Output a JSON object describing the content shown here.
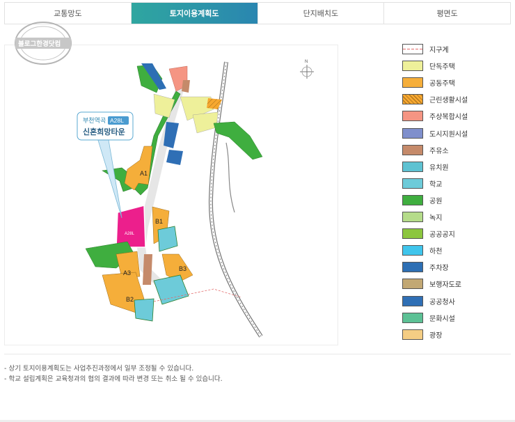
{
  "tabs": [
    {
      "label": "교통망도",
      "active": false
    },
    {
      "label": "토지이용계획도",
      "active": true
    },
    {
      "label": "단지배치도",
      "active": false
    },
    {
      "label": "평면도",
      "active": false
    }
  ],
  "map": {
    "stamp_text": "블로그한경닷컴",
    "callout": {
      "line1": "부천역곡",
      "tag": "A28L",
      "line2": "신혼희망타운"
    },
    "lots": [
      "A1",
      "A28L",
      "B1",
      "A3",
      "B3",
      "B2"
    ],
    "north_label": "N"
  },
  "legend": [
    {
      "label": "지구계",
      "color": "#ffffff",
      "pattern": "boundary"
    },
    {
      "label": "단독주택",
      "color": "#eef09a"
    },
    {
      "label": "공동주택",
      "color": "#f5ae3a"
    },
    {
      "label": "근린생활시설",
      "color": "#f7a830",
      "pattern": "hatch"
    },
    {
      "label": "주상복합시설",
      "color": "#f59583"
    },
    {
      "label": "도시지원시설",
      "color": "#7f8fcc"
    },
    {
      "label": "주유소",
      "color": "#c58a6a"
    },
    {
      "label": "유치원",
      "color": "#5ec2d2"
    },
    {
      "label": "학교",
      "color": "#6dcbd9"
    },
    {
      "label": "공원",
      "color": "#3fae3f"
    },
    {
      "label": "녹지",
      "color": "#b5dc8a"
    },
    {
      "label": "공공공지",
      "color": "#8cc63e"
    },
    {
      "label": "하천",
      "color": "#3fc5ec"
    },
    {
      "label": "주차장",
      "color": "#2d6fb4"
    },
    {
      "label": "보행자도로",
      "color": "#c2a874"
    },
    {
      "label": "공공청사",
      "color": "#2f6fb5"
    },
    {
      "label": "문화시설",
      "color": "#5cc195"
    },
    {
      "label": "광장",
      "color": "#f4cd84"
    }
  ],
  "notes": [
    "- 상기 토지이용계획도는 사업추진과정에서 일부 조정될 수 있습니다.",
    "- 학교 설립계획은 교육청과의 협의 결과에 따라 변경 또는 취소 될 수 있습니다."
  ]
}
